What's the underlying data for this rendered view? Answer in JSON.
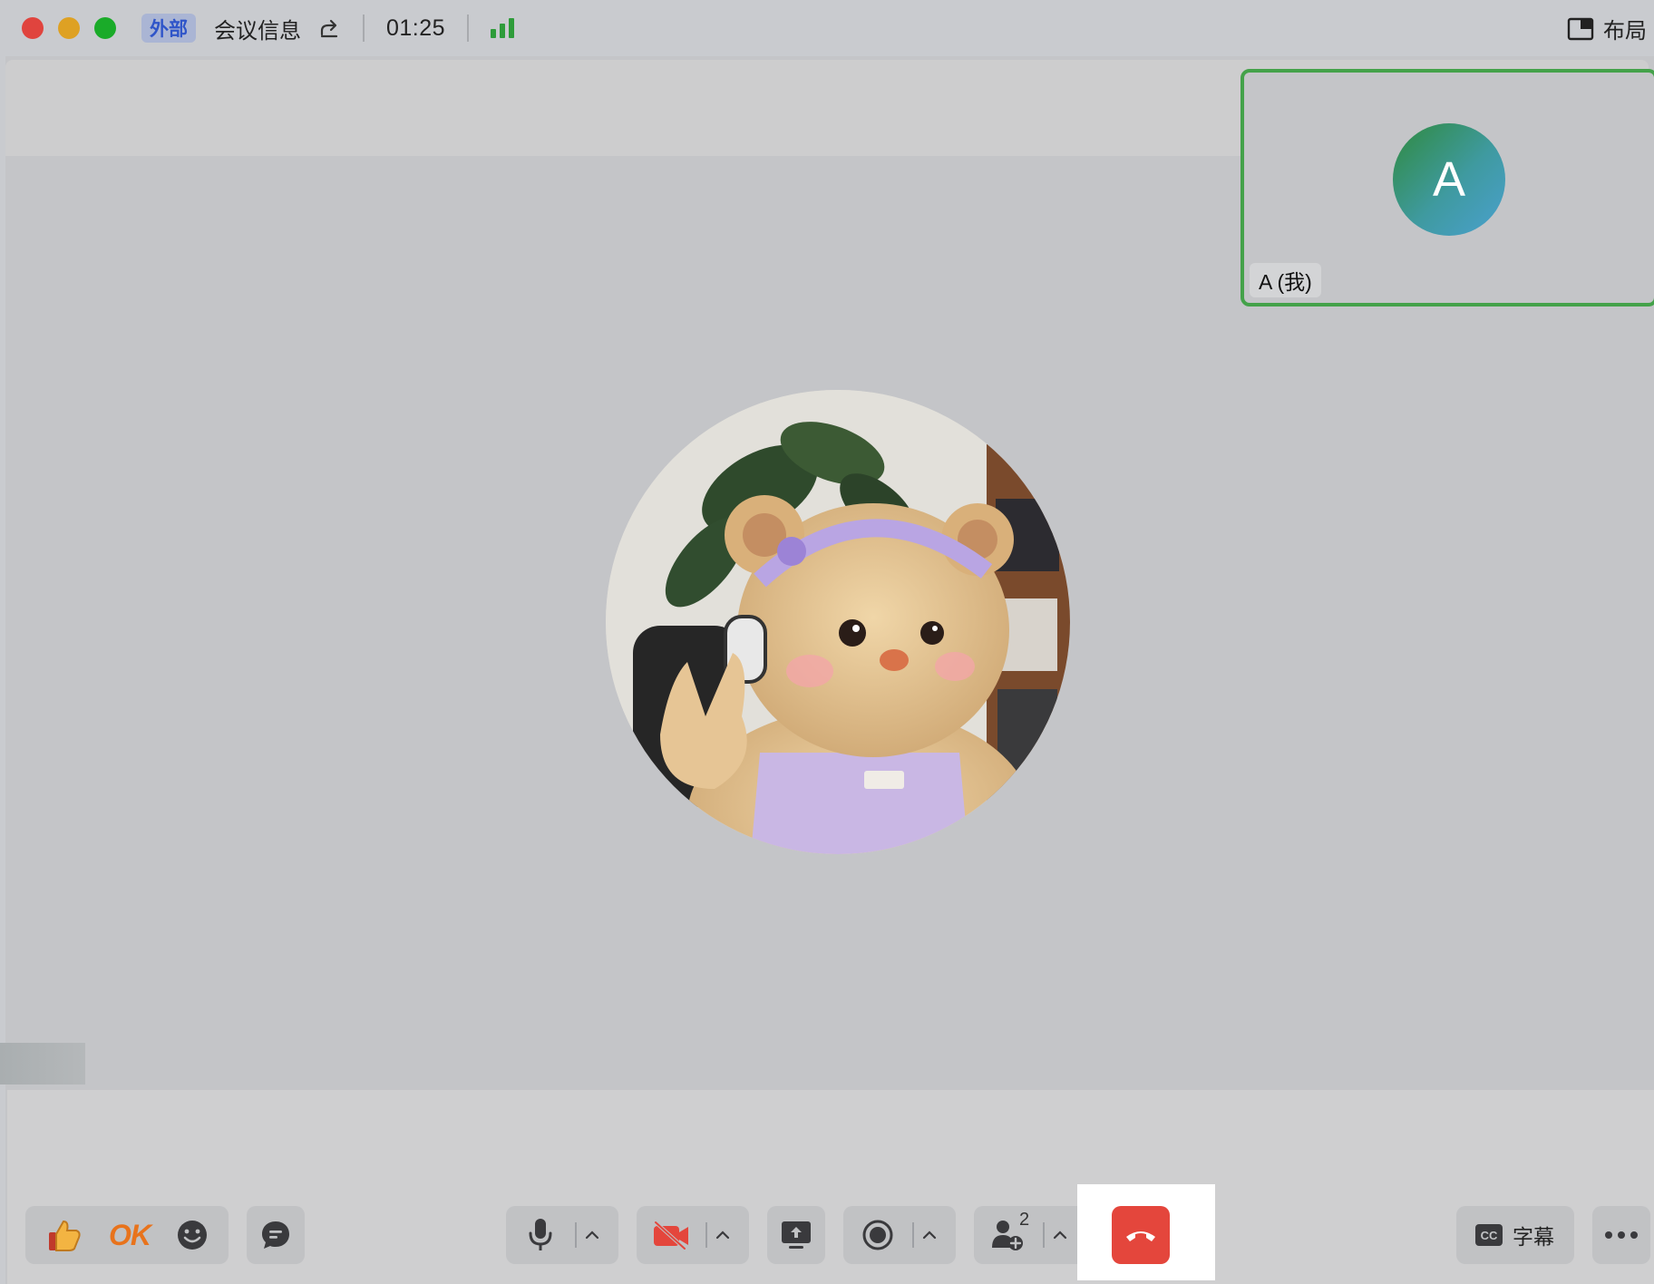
{
  "titlebar": {
    "external_badge": "外部",
    "meeting_info_label": "会议信息",
    "timer": "01:25",
    "layout_label": "布局"
  },
  "self_tile": {
    "avatar_letter": "A",
    "name_label": "A (我)"
  },
  "toolbar": {
    "reaction_ok": "OK",
    "participants_count": "2",
    "captions_label": "字幕"
  },
  "colors": {
    "accent_green": "#44a24a",
    "end_call_red": "#e4463c",
    "external_badge_text": "#2f55c9"
  },
  "icons": [
    "close-window-icon",
    "minimize-window-icon",
    "maximize-window-icon",
    "share-link-icon",
    "signal-strength-icon",
    "layout-icon",
    "thumbs-up-icon",
    "emoji-icon",
    "chat-icon",
    "microphone-icon",
    "camera-off-icon",
    "share-screen-icon",
    "record-icon",
    "participants-icon",
    "end-call-icon",
    "captions-icon",
    "more-icon"
  ]
}
